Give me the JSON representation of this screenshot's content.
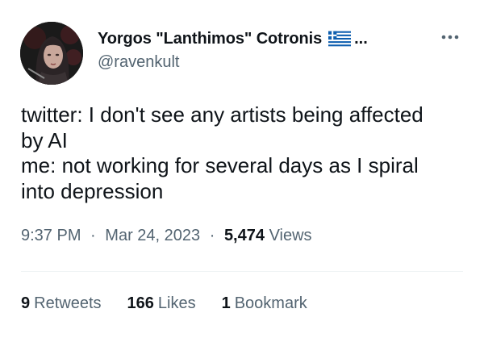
{
  "author": {
    "display_name": "Yorgos \"Lanthimos\" Cotronis",
    "truncation": "...",
    "flag_icon": "greek-flag-icon",
    "handle": "@ravenkult",
    "avatar_icon": "profile-portrait-avatar"
  },
  "more_icon": "more-options-icon",
  "tweet": {
    "lines": [
      "twitter: I don't see any artists being affected",
      "by AI",
      "me: not working for several days as I spiral",
      "into depression"
    ]
  },
  "meta": {
    "time": "9:37 PM",
    "separator": "·",
    "date": "Mar 24, 2023",
    "views_count": "5,474",
    "views_label": "Views"
  },
  "stats": {
    "retweets_count": "9",
    "retweets_label": "Retweets",
    "likes_count": "166",
    "likes_label": "Likes",
    "bookmarks_count": "1",
    "bookmarks_label": "Bookmark"
  },
  "colors": {
    "text_primary": "#0f1419",
    "text_secondary": "#536471",
    "divider": "#eff3f4",
    "flag_blue": "#0d5eaf"
  }
}
